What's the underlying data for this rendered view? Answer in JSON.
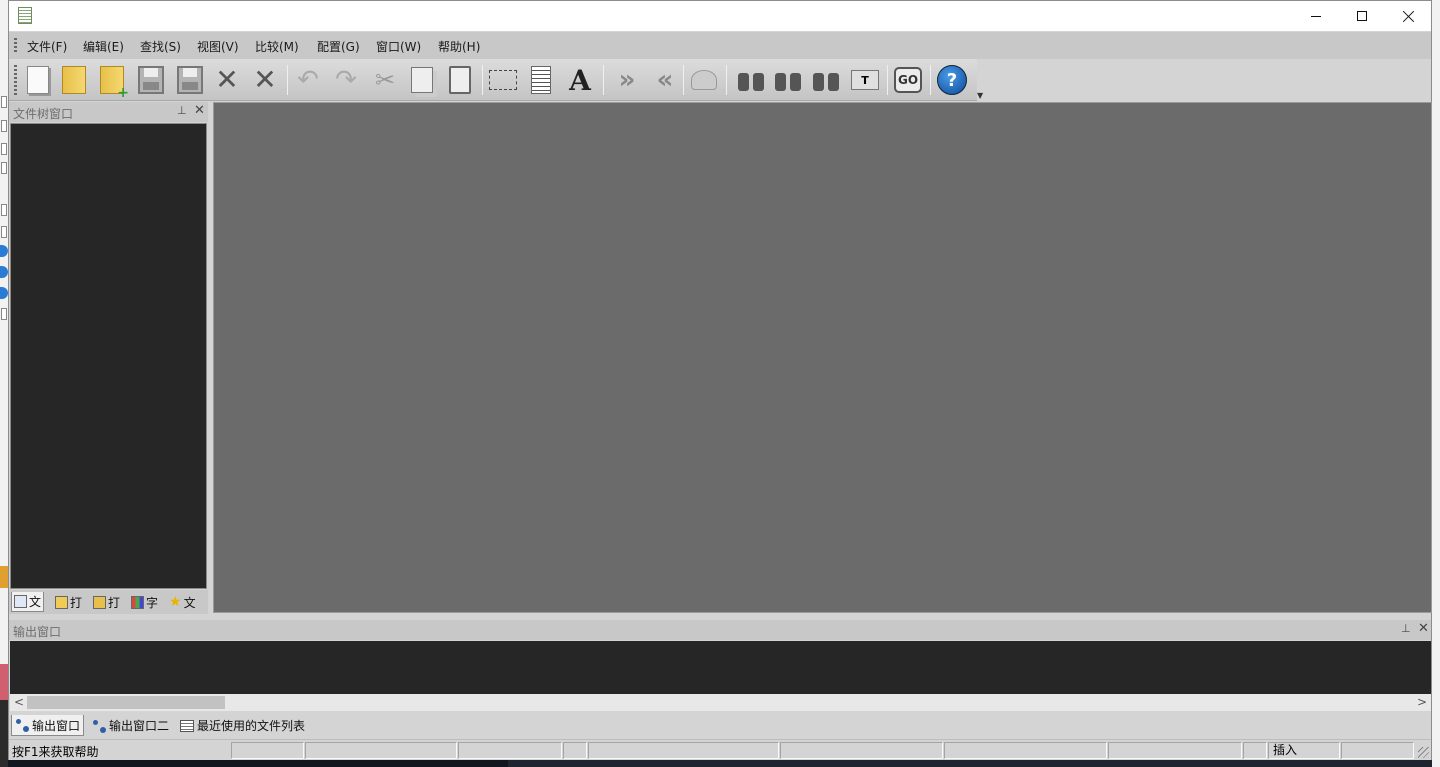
{
  "menu": {
    "items": [
      "文件(F)",
      "编辑(E)",
      "查找(S)",
      "视图(V)",
      "比较(M)",
      "配置(G)",
      "窗口(W)",
      "帮助(H)"
    ]
  },
  "toolbar": {
    "buttons": [
      {
        "name": "new-file",
        "icon": "blank-document-icon"
      },
      {
        "name": "open-file",
        "icon": "folder-icon"
      },
      {
        "name": "open-project",
        "icon": "folder-plus-icon"
      },
      {
        "name": "save",
        "icon": "floppy-disk-icon"
      },
      {
        "name": "save-all",
        "icon": "floppy-disk-plus-icon"
      },
      {
        "name": "close",
        "icon": "close-x-icon"
      },
      {
        "name": "close-all",
        "icon": "close-x-plus-icon"
      },
      {
        "name": "undo",
        "icon": "undo-arrow-icon"
      },
      {
        "name": "redo",
        "icon": "redo-arrow-icon"
      },
      {
        "name": "cut",
        "icon": "scissors-icon"
      },
      {
        "name": "copy",
        "icon": "copy-icon"
      },
      {
        "name": "paste",
        "icon": "clipboard-icon"
      },
      {
        "name": "select",
        "icon": "selection-icon"
      },
      {
        "name": "list",
        "icon": "list-icon"
      },
      {
        "name": "font",
        "icon": "letter-a-icon"
      },
      {
        "name": "indent",
        "icon": "double-chevron-right-icon"
      },
      {
        "name": "outdent",
        "icon": "double-chevron-left-icon"
      },
      {
        "name": "clear",
        "icon": "bell-clear-icon"
      },
      {
        "name": "find",
        "icon": "binoculars-icon"
      },
      {
        "name": "find-next",
        "icon": "binoculars-next-icon"
      },
      {
        "name": "find-prev",
        "icon": "binoculars-prev-icon"
      },
      {
        "name": "replace",
        "icon": "text-replace-icon"
      },
      {
        "name": "goto",
        "icon": "go-icon"
      },
      {
        "name": "help",
        "icon": "help-icon"
      }
    ],
    "go_label": "GO",
    "help_label": "?",
    "font_label": "A"
  },
  "filetree": {
    "title": "文件树窗口",
    "tabs": [
      {
        "label": "文",
        "icon": "tree-icon"
      },
      {
        "label": "打",
        "icon": "folder-icon"
      },
      {
        "label": "打",
        "icon": "folder-open-icon"
      },
      {
        "label": "字",
        "icon": "chart-icon"
      },
      {
        "label": "文",
        "icon": "star-icon"
      }
    ]
  },
  "output": {
    "title": "输出窗口",
    "tabs": [
      "输出窗口",
      "输出窗口二",
      "最近使用的文件列表"
    ]
  },
  "status": {
    "help_text": "按F1来获取帮助",
    "mode": "插入"
  },
  "colors": {
    "panel_dark": "#262626",
    "doc_area": "#6b6b6b",
    "chrome": "#d4d4d4"
  }
}
